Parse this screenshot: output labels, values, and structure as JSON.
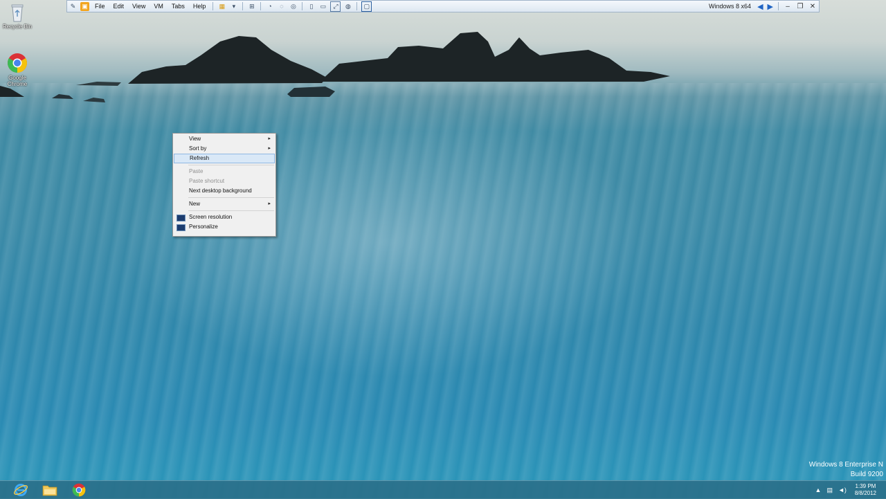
{
  "vm_toolbar": {
    "menus": [
      "File",
      "Edit",
      "View",
      "VM",
      "Tabs",
      "Help"
    ],
    "vm_title": "Windows 8 x64",
    "icons": [
      "pin-icon",
      "vmware-icon",
      "library-icon",
      "dropdown-arrow-icon",
      "network-icon",
      "snapshot-icon",
      "revert-icon",
      "snapshot-manager-icon",
      "sidebar-icon",
      "thumbnail-icon",
      "fullscreen-icon",
      "unity-icon",
      "console-view-icon",
      "back-arrow-icon",
      "forward-arrow-icon",
      "minimize-icon",
      "restore-icon",
      "close-icon"
    ]
  },
  "desktop_icons": [
    {
      "label": "Recycle Bin",
      "icon": "recycle-bin-icon"
    },
    {
      "label": "Google Chrome",
      "icon": "chrome-icon"
    }
  ],
  "context_menu": {
    "items": [
      {
        "label": "View",
        "submenu": true,
        "enabled": true
      },
      {
        "label": "Sort by",
        "submenu": true,
        "enabled": true
      },
      {
        "label": "Refresh",
        "submenu": false,
        "enabled": true,
        "highlighted": true
      },
      {
        "label": "Paste",
        "submenu": false,
        "enabled": false
      },
      {
        "label": "Paste shortcut",
        "submenu": false,
        "enabled": false
      },
      {
        "label": "Next desktop background",
        "submenu": false,
        "enabled": true
      },
      {
        "label": "New",
        "submenu": true,
        "enabled": true
      },
      {
        "label": "Screen resolution",
        "submenu": false,
        "enabled": true,
        "icon": "display-icon"
      },
      {
        "label": "Personalize",
        "submenu": false,
        "enabled": true,
        "icon": "personalize-icon"
      }
    ],
    "submenu_arrow": "▸"
  },
  "watermark": {
    "line1": "Windows 8 Enterprise N",
    "line2": "Build 9200"
  },
  "taskbar": {
    "apps": [
      "internet-explorer-icon",
      "file-explorer-icon",
      "chrome-icon"
    ],
    "tray": {
      "icons": [
        "show-hidden-icons-icon",
        "network-icon",
        "volume-icon"
      ],
      "time": "1:39 PM",
      "date": "8/8/2012"
    }
  },
  "colors": {
    "menu_highlight": "#d9e8f7",
    "taskbar": "#2a708a",
    "sea": "#2f87ab"
  }
}
